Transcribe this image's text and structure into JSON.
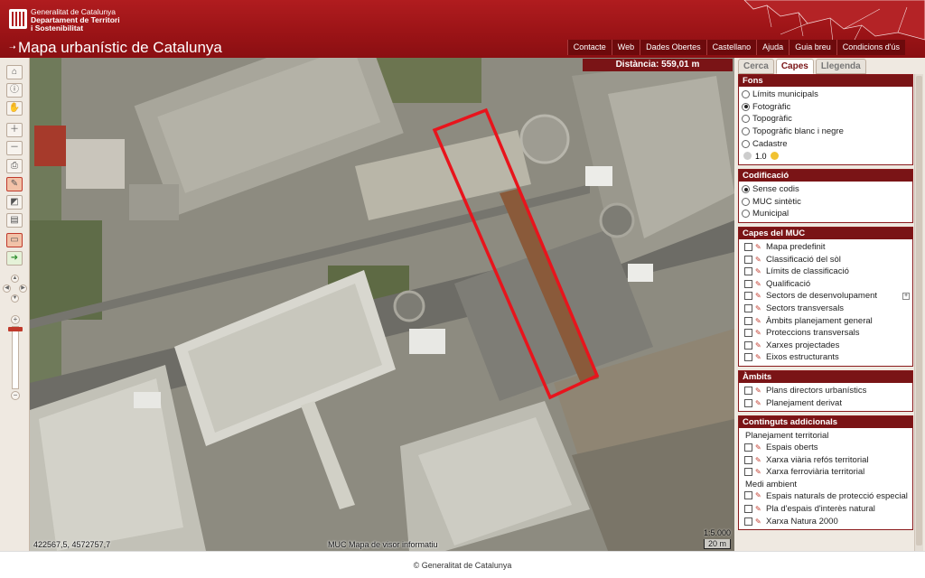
{
  "header": {
    "org_line1": "Generalitat de Catalunya",
    "org_line2": "Departament de Territori",
    "org_line3": "i Sostenibilitat",
    "app_title": "Mapa urbanístic de Catalunya",
    "nav": [
      "Contacte",
      "Web",
      "Dades Obertes",
      "Castellano",
      "Ajuda",
      "Guia breu",
      "Condicions d'ús"
    ]
  },
  "map": {
    "distance": "Distància: 559,01 m",
    "coordinates": "422567,5, 4572757,7",
    "credits": "MUC Mapa de visor informatiu",
    "scale_ratio": "1:5.000",
    "scale_bar": "20 m"
  },
  "panel": {
    "tabs": [
      {
        "label": "Cerca",
        "active": false
      },
      {
        "label": "Capes",
        "active": true
      },
      {
        "label": "Llegenda",
        "active": false
      }
    ],
    "fons": {
      "title": "Fons",
      "options": [
        {
          "label": "Límits municipals",
          "selected": false
        },
        {
          "label": "Fotogràfic",
          "selected": true
        },
        {
          "label": "Topogràfic",
          "selected": false
        },
        {
          "label": "Topogràfic blanc i negre",
          "selected": false
        },
        {
          "label": "Cadastre",
          "selected": false
        }
      ],
      "opacity": "1.0"
    },
    "codificacio": {
      "title": "Codificació",
      "options": [
        {
          "label": "Sense codis",
          "selected": true
        },
        {
          "label": "MUC sintètic",
          "selected": false
        },
        {
          "label": "Municipal",
          "selected": false
        }
      ]
    },
    "capes_muc": {
      "title": "Capes del MUC",
      "items": [
        "Mapa predefinit",
        "Classificació del sòl",
        "Límits de classificació",
        "Qualificació",
        "Sectors de desenvolupament",
        "Sectors transversals",
        "Àmbits planejament general",
        "Proteccions transversals",
        "Xarxes projectades",
        "Eixos estructurants"
      ],
      "expand": "+"
    },
    "ambits": {
      "title": "Àmbits",
      "items": [
        "Plans directors urbanístics",
        "Planejament derivat"
      ]
    },
    "continguts": {
      "title": "Continguts addicionals",
      "group1": "Planejament territorial",
      "group1_items": [
        "Espais oberts",
        "Xarxa viària refós territorial",
        "Xarxa ferroviària territorial"
      ],
      "group2": "Medi ambient",
      "group2_items": [
        "Espais naturals de protecció especial",
        "Pla d'espais d'interès natural",
        "Xarxa Natura 2000"
      ]
    }
  },
  "footer": {
    "copyright": "© Generalitat de Catalunya"
  },
  "colors": {
    "brand_red": "#9a1316",
    "section_red": "#7a1416",
    "selection_red": "#e8141c"
  }
}
